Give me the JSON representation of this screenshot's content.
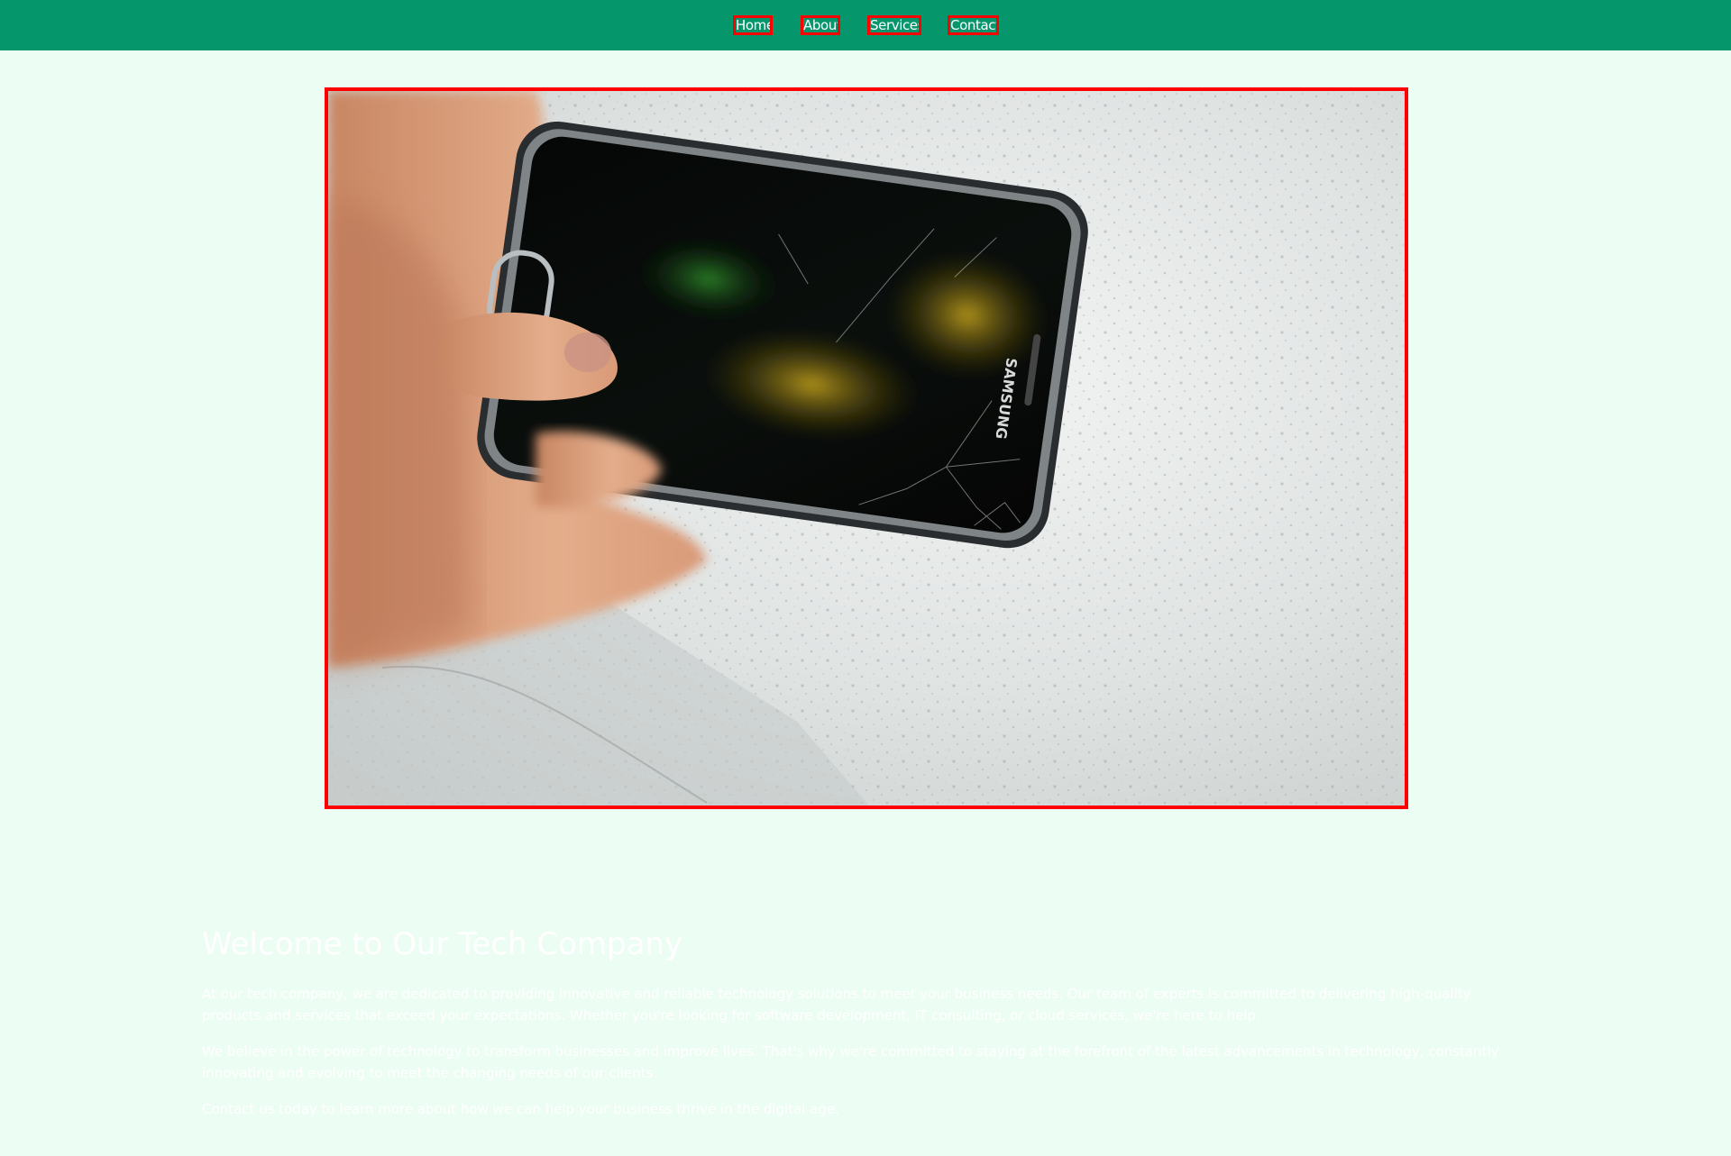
{
  "nav": {
    "items": [
      {
        "label": "Home"
      },
      {
        "label": "About"
      },
      {
        "label": "Services"
      },
      {
        "label": "Contact"
      }
    ]
  },
  "hero": {
    "image_icon": "broken-samsung-phone-photo",
    "brand_text": "SAMSUNG"
  },
  "main": {
    "heading": "Welcome to Our Tech Company",
    "paragraphs": [
      "At our tech company, we are dedicated to providing innovative and reliable technology solutions to meet your business needs. Our team of experts is committed to delivering high-quality products and services that exceed your expectations. Whether you're looking for software development, IT consulting, or cloud services, we're here to help.",
      "We believe in the power of technology to transform businesses and improve lives. That's why we're committed to staying at the forefront of the latest advancements in technology, constantly innovating and evolving to meet the changing needs of our clients.",
      "Contact us today to learn more about how we can help your business thrive in the digital age."
    ]
  },
  "colors": {
    "header_bg": "#05976b",
    "page_bg": "#ecfdf4",
    "outline": "#ff0000",
    "text": "#ffffff"
  }
}
